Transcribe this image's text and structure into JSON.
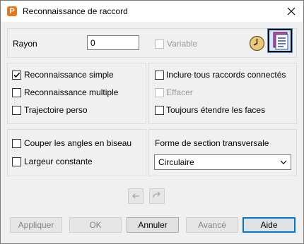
{
  "window": {
    "title": "Reconnaissance de raccord",
    "app_icon_letter": "P"
  },
  "rayon": {
    "label": "Rayon",
    "value": "0",
    "variable_label": "Variable",
    "variable_checked": false,
    "variable_enabled": false
  },
  "tools": [
    {
      "name": "clock-icon",
      "selected": false
    },
    {
      "name": "select-list-icon",
      "selected": true
    }
  ],
  "recognition": {
    "simple_label": "Reconnaissance simple",
    "simple_checked": true,
    "multiple_label": "Reconnaissance multiple",
    "multiple_checked": false,
    "trajectory_label": "Trajectoire perso",
    "trajectory_checked": false
  },
  "connections": {
    "include_label": "Inclure tous raccords connectés",
    "include_checked": false,
    "erase_label": "Effacer",
    "erase_checked": false,
    "erase_enabled": false,
    "extend_label": "Toujours étendre les faces",
    "extend_checked": false
  },
  "corners": {
    "bevel_label": "Couper les angles en biseau",
    "bevel_checked": false,
    "width_label": "Largeur constante",
    "width_checked": false
  },
  "section": {
    "label": "Forme de section transversale",
    "selected": "Circulaire"
  },
  "buttons": {
    "apply": "Appliquer",
    "ok": "OK",
    "cancel": "Annuler",
    "advanced": "Avancé",
    "help": "Aide"
  },
  "colors": {
    "accent": "#0078d7",
    "app_icon": "#e8761a"
  }
}
